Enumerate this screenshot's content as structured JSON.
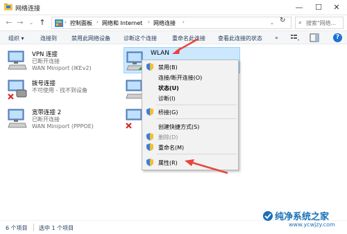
{
  "window": {
    "title": "网络连接",
    "controls": {
      "minimize": "—",
      "maximize": "☐",
      "close": "✕"
    }
  },
  "nav": {
    "back": "←",
    "forward": "→",
    "recent": "⌄",
    "up": "↑",
    "refresh": "↻"
  },
  "address": {
    "breadcrumbs": [
      "控制面板",
      "网络和 Internet",
      "网络连接"
    ],
    "separator": "›",
    "dropdown": "⌄"
  },
  "search": {
    "placeholder": "搜索\"网络...",
    "icon": "search-icon"
  },
  "commandbar": {
    "organize": "组织 ▾",
    "connect_to": "连接到",
    "disable_device": "禁用此网络设备",
    "diagnose": "诊断这个连接",
    "rename": "重命名此连接",
    "view_status": "查看此连接的状态",
    "more": "»",
    "help": "?"
  },
  "connections": [
    {
      "name": "VPN 连接",
      "status": "已断开连接",
      "device": "WAN Miniport (IKEv2)"
    },
    {
      "name": "WLAN",
      "status": "",
      "device": ""
    },
    {
      "name": "拨号连接",
      "status": "不可使用 - 找不到设备",
      "device": ""
    },
    {
      "name": "",
      "status": "",
      "device": ""
    },
    {
      "name": "宽带连接 2",
      "status": "已断开连接",
      "device": "WAN Miniport (PPPOE)"
    },
    {
      "name": "",
      "status": "",
      "device": ""
    }
  ],
  "context_menu": {
    "items": [
      {
        "label": "禁用(B)",
        "shield": true
      },
      {
        "label": "连接/断开连接(O)",
        "shield": false
      },
      {
        "label": "状态(U)",
        "shield": false
      },
      {
        "label": "诊断(I)",
        "shield": false
      },
      {
        "label": "桥接(G)",
        "shield": true
      },
      {
        "label": "创建快捷方式(S)",
        "shield": false
      },
      {
        "label": "删除(D)",
        "shield": true
      },
      {
        "label": "重命名(M)",
        "shield": true
      },
      {
        "label": "属性(R)",
        "shield": true
      }
    ]
  },
  "statusbar": {
    "count": "6 个项目",
    "selected": "选中 1 个项目"
  },
  "watermark": {
    "text": "纯净系统之家",
    "url": "www.ycwjzy.com"
  },
  "colors": {
    "accent": "#1e395b",
    "selection": "#cce8ff",
    "annotation_arrow": "#e8453c"
  }
}
